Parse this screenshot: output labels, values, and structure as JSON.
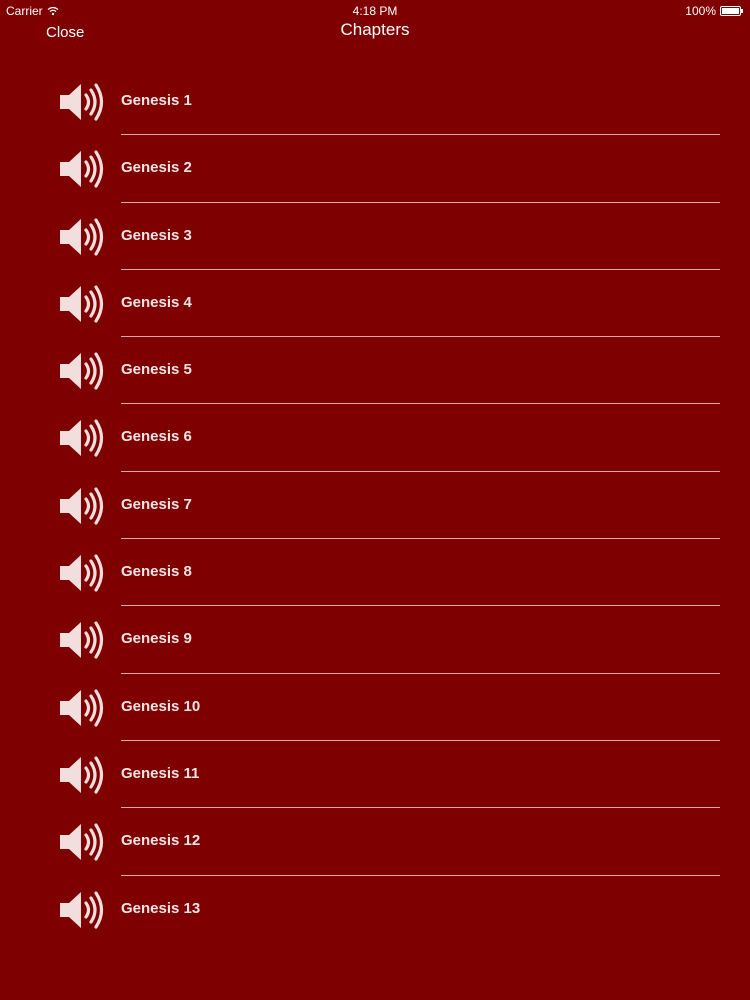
{
  "status_bar": {
    "carrier": "Carrier",
    "time": "4:18 PM",
    "battery": "100%"
  },
  "nav": {
    "close_label": "Close",
    "title": "Chapters"
  },
  "chapters": [
    {
      "label": "Genesis 1"
    },
    {
      "label": "Genesis 2"
    },
    {
      "label": "Genesis 3"
    },
    {
      "label": "Genesis 4"
    },
    {
      "label": "Genesis 5"
    },
    {
      "label": "Genesis 6"
    },
    {
      "label": "Genesis 7"
    },
    {
      "label": "Genesis 8"
    },
    {
      "label": "Genesis 9"
    },
    {
      "label": "Genesis 10"
    },
    {
      "label": "Genesis 11"
    },
    {
      "label": "Genesis 12"
    },
    {
      "label": "Genesis 13"
    }
  ],
  "icons": {
    "row_icon": "speaker-volume-icon",
    "status_wifi": "wifi-icon",
    "status_battery": "battery-icon"
  },
  "colors": {
    "background": "#7f0000",
    "text": "#ffffff",
    "divider": "#e8c9c9"
  }
}
